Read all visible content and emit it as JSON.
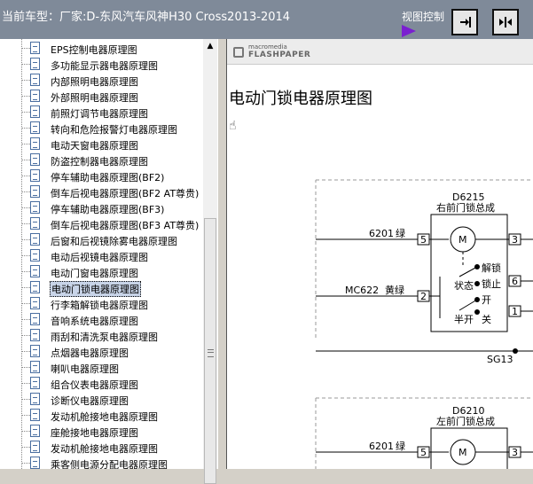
{
  "header": {
    "title": "当前车型：厂家:D-东风汽车风神H30 Cross2013-2014",
    "view_control_label": "视图控制"
  },
  "viewer": {
    "brand_top": "macromedia",
    "brand_name": "FLASHPAPER",
    "doc_title": "电动门锁电器原理图"
  },
  "tree": {
    "items": [
      {
        "label": "EPS控制电器原理图"
      },
      {
        "label": "多功能显示器电器原理图"
      },
      {
        "label": "内部照明电器原理图"
      },
      {
        "label": "外部照明电器原理图"
      },
      {
        "label": "前照灯调节电器原理图"
      },
      {
        "label": "转向和危险报警灯电器原理图"
      },
      {
        "label": "电动天窗电器原理图"
      },
      {
        "label": "防盗控制器电器原理图"
      },
      {
        "label": "停车辅助电器原理图(BF2)"
      },
      {
        "label": "倒车后视电器原理图(BF2 AT尊贵)"
      },
      {
        "label": "停车辅助电器原理图(BF3)"
      },
      {
        "label": "倒车后视电器原理图(BF3 AT尊贵)"
      },
      {
        "label": "后窗和后视镜除雾电器原理图"
      },
      {
        "label": "电动后视镜电器原理图"
      },
      {
        "label": "电动门窗电器原理图"
      },
      {
        "label": "电动门锁电器原理图",
        "selected": true
      },
      {
        "label": "行李箱解锁电器原理图"
      },
      {
        "label": "音响系统电器原理图"
      },
      {
        "label": "雨刮和清洗泵电器原理图"
      },
      {
        "label": "点烟器电器原理图"
      },
      {
        "label": "喇叭电器原理图"
      },
      {
        "label": "组合仪表电器原理图"
      },
      {
        "label": "诊断仪电器原理图"
      },
      {
        "label": "发动机舱接地电器原理图"
      },
      {
        "label": "座舱接地电器原理图"
      },
      {
        "label": "发动机舱接地电器原理图"
      },
      {
        "label": "乘客侧电源分配电器原理图"
      }
    ]
  },
  "diagram": {
    "upper": {
      "id": "D6215",
      "name": "右前门锁总成",
      "wire1": "6201",
      "wire1_color": "绿",
      "wire2": "MC622",
      "wire2_color": "黄绿",
      "pin_5": "5",
      "pin_3": "3",
      "pin_6": "6",
      "pin_2": "2",
      "pin_1": "1",
      "motor": "M",
      "unlock": "解锁",
      "state": "状态",
      "lock": "锁止",
      "open": "开",
      "half_open": "半开",
      "close": "关",
      "ground": "SG13"
    },
    "lower": {
      "id": "D6210",
      "name": "左前门锁总成",
      "wire1": "6201",
      "wire1_color": "绿",
      "pin_5": "5",
      "pin_3": "3",
      "motor": "M"
    }
  }
}
